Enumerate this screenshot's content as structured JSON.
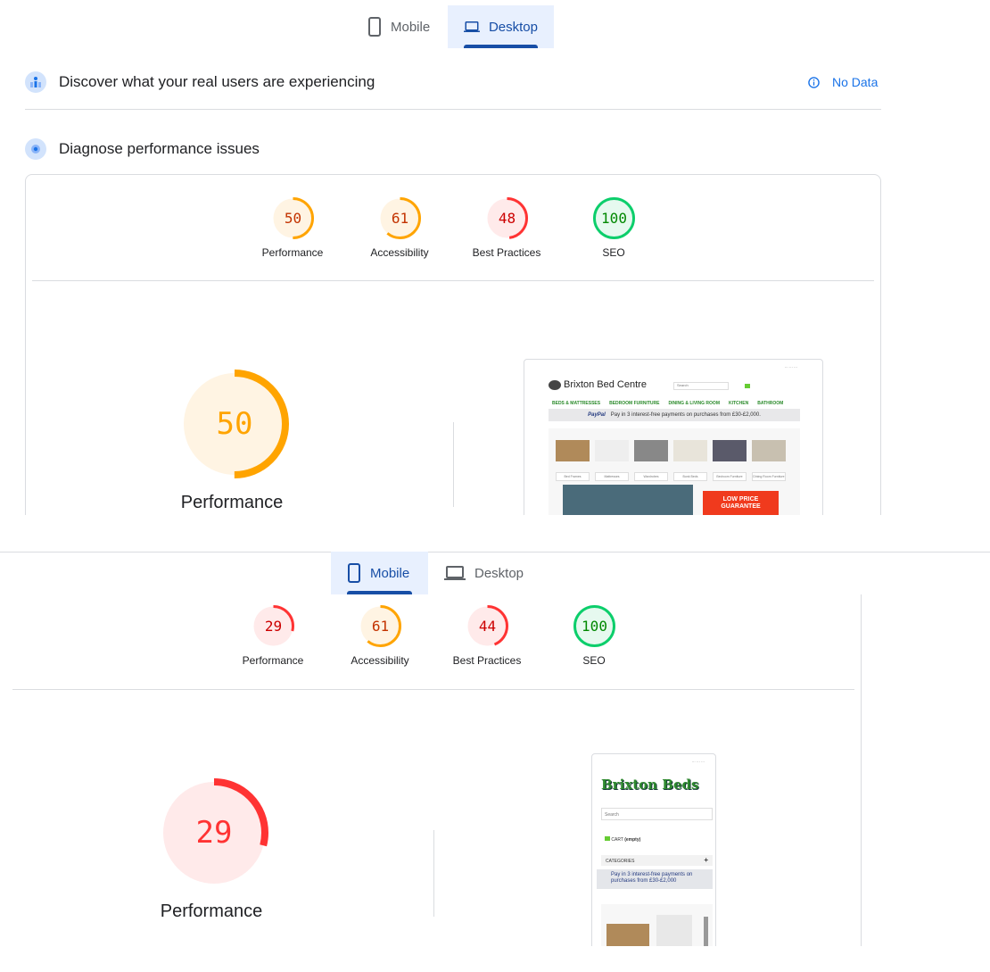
{
  "desktop_view": {
    "tabs": [
      {
        "label": "Mobile",
        "icon": "phone-icon",
        "active": false
      },
      {
        "label": "Desktop",
        "icon": "laptop-icon",
        "active": true
      }
    ],
    "field_section": {
      "title": "Discover what your real users are experiencing",
      "status": "No Data",
      "status_icon": "info-icon"
    },
    "lab_section": {
      "title": "Diagnose performance issues"
    },
    "scores": [
      {
        "label": "Performance",
        "value": 50
      },
      {
        "label": "Accessibility",
        "value": 61
      },
      {
        "label": "Best Practices",
        "value": 48
      },
      {
        "label": "SEO",
        "value": 100
      }
    ],
    "main_score": {
      "label": "Performance",
      "value": 50
    },
    "screenshot": {
      "site_name": "Brixton Bed Centre",
      "search_placeholder": "Search",
      "nav": [
        "BEDS & MATTRESSES",
        "BEDROOM FURNITURE",
        "DINING & LIVING ROOM",
        "KITCHEN",
        "BATHROOM"
      ],
      "paypal": "PayPal",
      "paypal_text": "Pay in 3 interest-free payments on purchases from £30-£2,000.",
      "categories": [
        "Bed Frames",
        "Mattresses",
        "Wardrobes",
        "Bunk Beds",
        "Bedroom Furniture",
        "Dining Room Furniture"
      ],
      "banner": "LOW PRICE GUARANTEE"
    }
  },
  "mobile_view": {
    "tabs": [
      {
        "label": "Mobile",
        "icon": "phone-icon",
        "active": true
      },
      {
        "label": "Desktop",
        "icon": "laptop-icon",
        "active": false
      }
    ],
    "scores": [
      {
        "label": "Performance",
        "value": 29
      },
      {
        "label": "Accessibility",
        "value": 61
      },
      {
        "label": "Best Practices",
        "value": 44
      },
      {
        "label": "SEO",
        "value": 100
      }
    ],
    "main_score": {
      "label": "Performance",
      "value": 29
    },
    "screenshot": {
      "site_name": "Brixton Beds",
      "search_placeholder": "Search",
      "cart": "(empty)",
      "categories_label": "CATEGORIES",
      "paypal_text": "Pay in 3 interest-free payments on purchases from £30-£2,000"
    }
  },
  "colors": {
    "fail": "#ff3333",
    "average": "#ffa400",
    "pass": "#0cce6b",
    "accent": "#174ea6",
    "link": "#1a73e8"
  }
}
